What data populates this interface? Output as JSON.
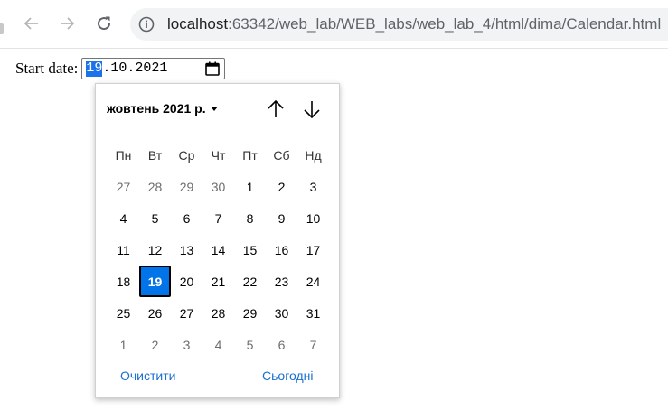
{
  "browser": {
    "url_host": "localhost",
    "url_rest": ":63342/web_lab/WEB_labs/web_lab_4/html/dima/Calendar.html"
  },
  "form": {
    "start_label": "Start date:",
    "date_day": "19",
    "date_rest": ".10.2021"
  },
  "calendar": {
    "month_label": "жовтень 2021 р.",
    "weekdays": [
      "Пн",
      "Вт",
      "Ср",
      "Чт",
      "Пт",
      "Сб",
      "Нд"
    ],
    "weeks": [
      [
        {
          "d": "27",
          "other": true
        },
        {
          "d": "28",
          "other": true
        },
        {
          "d": "29",
          "other": true
        },
        {
          "d": "30",
          "other": true
        },
        {
          "d": "1"
        },
        {
          "d": "2"
        },
        {
          "d": "3"
        }
      ],
      [
        {
          "d": "4"
        },
        {
          "d": "5"
        },
        {
          "d": "6"
        },
        {
          "d": "7"
        },
        {
          "d": "8"
        },
        {
          "d": "9"
        },
        {
          "d": "10"
        }
      ],
      [
        {
          "d": "11"
        },
        {
          "d": "12"
        },
        {
          "d": "13"
        },
        {
          "d": "14"
        },
        {
          "d": "15"
        },
        {
          "d": "16"
        },
        {
          "d": "17"
        }
      ],
      [
        {
          "d": "18"
        },
        {
          "d": "19",
          "selected": true
        },
        {
          "d": "20"
        },
        {
          "d": "21"
        },
        {
          "d": "22"
        },
        {
          "d": "23"
        },
        {
          "d": "24"
        }
      ],
      [
        {
          "d": "25"
        },
        {
          "d": "26"
        },
        {
          "d": "27"
        },
        {
          "d": "28"
        },
        {
          "d": "29"
        },
        {
          "d": "30"
        },
        {
          "d": "31"
        }
      ],
      [
        {
          "d": "1",
          "other": true
        },
        {
          "d": "2",
          "other": true
        },
        {
          "d": "3",
          "other": true
        },
        {
          "d": "4",
          "other": true
        },
        {
          "d": "5",
          "other": true
        },
        {
          "d": "6",
          "other": true
        },
        {
          "d": "7",
          "other": true
        }
      ]
    ],
    "clear_label": "Очистити",
    "today_label": "Сьогодні"
  },
  "colors": {
    "selected_day": "#0074e8",
    "link": "#1a6fd1",
    "segment_highlight": "#1a73e8"
  },
  "icons": {
    "back": "arrow-left-icon",
    "forward": "arrow-right-icon",
    "reload": "reload-icon",
    "site_info": "info-icon",
    "calendar": "calendar-icon",
    "prev_month": "arrow-up-icon",
    "next_month": "arrow-down-icon",
    "month_dropdown": "caret-down-icon"
  }
}
